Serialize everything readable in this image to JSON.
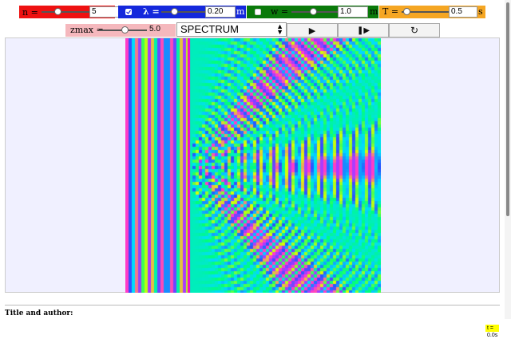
{
  "controls": {
    "n": {
      "label": "n =",
      "value": "5",
      "color": "#ee1111"
    },
    "lambda": {
      "label": "λ =",
      "value": "0.20",
      "unit": "m",
      "color": "#1428dc"
    },
    "w": {
      "label": "w =",
      "value": "1.0",
      "unit": "m",
      "color": "#0a7a0a"
    },
    "T": {
      "label": "T =",
      "value": "0.5",
      "unit": "s",
      "color": "#f5a623"
    },
    "zmax": {
      "label": "zmax =",
      "value": "5.0",
      "color": "#f5b8bd"
    }
  },
  "colormap": {
    "selected": "SPECTRUM"
  },
  "buttons": {
    "play": "▶",
    "step": "❚▶",
    "reset": "↻"
  },
  "time": "t = 0.0s",
  "footer": {
    "title_author": "Title and author:"
  }
}
